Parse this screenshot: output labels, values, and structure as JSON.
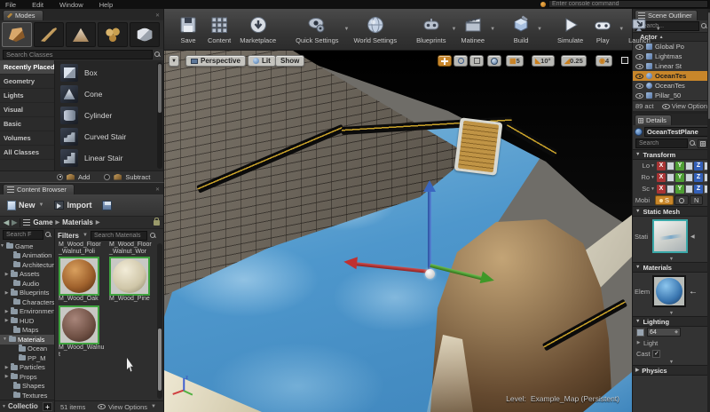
{
  "menu": {
    "items": [
      {
        "label": "File"
      },
      {
        "label": "Edit"
      },
      {
        "label": "Window"
      },
      {
        "label": "Help"
      }
    ]
  },
  "console": {
    "placeholder": "Enter console command"
  },
  "toolbar": {
    "buttons": [
      {
        "label": "Save"
      },
      {
        "label": "Content"
      },
      {
        "label": "Marketplace"
      },
      {
        "label": "Quick Settings"
      },
      {
        "label": "World Settings"
      },
      {
        "label": "Blueprints"
      },
      {
        "label": "Matinee"
      },
      {
        "label": "Build"
      },
      {
        "label": "Simulate"
      },
      {
        "label": "Play"
      },
      {
        "label": "Launch"
      }
    ]
  },
  "modes": {
    "title": "Modes",
    "search_placeholder": "Search Classes",
    "categories": [
      {
        "label": "Recently Placed"
      },
      {
        "label": "Geometry"
      },
      {
        "label": "Lights"
      },
      {
        "label": "Visual"
      },
      {
        "label": "Basic"
      },
      {
        "label": "Volumes"
      },
      {
        "label": "All Classes"
      }
    ],
    "items": [
      {
        "label": "Box"
      },
      {
        "label": "Cone"
      },
      {
        "label": "Cylinder"
      },
      {
        "label": "Curved Stair"
      },
      {
        "label": "Linear Stair"
      }
    ],
    "add_label": "Add",
    "subtract_label": "Subtract"
  },
  "content_browser": {
    "title": "Content Browser",
    "new_label": "New",
    "import_label": "Import",
    "breadcrumb": {
      "root": "Game",
      "current": "Materials"
    },
    "tree_search_placeholder": "Search F",
    "filters_label": "Filters",
    "search_placeholder": "Search Materials",
    "tree": [
      {
        "label": "Game"
      },
      {
        "label": "Animation"
      },
      {
        "label": "Architecture"
      },
      {
        "label": "Assets"
      },
      {
        "label": "Audio"
      },
      {
        "label": "Blueprints"
      },
      {
        "label": "Characters"
      },
      {
        "label": "Environments"
      },
      {
        "label": "HUD"
      },
      {
        "label": "Maps"
      },
      {
        "label": "Materials"
      },
      {
        "label": "Ocean"
      },
      {
        "label": "PP_M"
      },
      {
        "label": "Particles"
      },
      {
        "label": "Props"
      },
      {
        "label": "Shapes"
      },
      {
        "label": "Textures"
      }
    ],
    "collections_label": "Collectio",
    "asset_labels_top": [
      {
        "name": "M_Wood_Floor_Walnut_Poli"
      },
      {
        "name": "M_Wood_Floor_Walnut_Wor"
      }
    ],
    "assets": [
      {
        "name": "M_Wood_Oak"
      },
      {
        "name": "M_Wood_Pine"
      },
      {
        "name": "M_Wood_Walnut"
      }
    ],
    "status": "51 items",
    "view_options_label": "View Options"
  },
  "outliner": {
    "title": "Scene Outliner",
    "search_placeholder": "Search...",
    "column": "Actor",
    "rows": [
      {
        "label": "Global Po"
      },
      {
        "label": "Lightmas"
      },
      {
        "label": "Linear St"
      },
      {
        "label": "OceanTes"
      },
      {
        "label": "OceanTes"
      },
      {
        "label": "Pillar_50"
      }
    ],
    "footer_count": "89 act",
    "view_options_label": "View Option"
  },
  "details": {
    "title": "Details",
    "actor_name": "OceanTestPlane",
    "search_placeholder": "Search",
    "transform": {
      "title": "Transform",
      "rows": [
        {
          "label": "Lo"
        },
        {
          "label": "Ro"
        },
        {
          "label": "Sc"
        }
      ],
      "axes": [
        "X",
        "Y",
        "Z"
      ],
      "mobility_label": "Mobi",
      "mobility_seg1": "S",
      "mobility_seg3": "N"
    },
    "static_mesh": {
      "title": "Static Mesh",
      "row_label": "Stati"
    },
    "materials": {
      "title": "Materials",
      "row_label": "Elem"
    },
    "lighting": {
      "title": "Lighting",
      "value": "64",
      "row2_label": "Light",
      "row3_label": "Cast"
    },
    "physics": {
      "title": "Physics"
    }
  },
  "viewport": {
    "perspective_label": "Perspective",
    "lit_label": "Lit",
    "show_label": "Show",
    "grid_snap": "5",
    "angle_snap": "10°",
    "scale_snap": "0.25",
    "camera_speed": "4",
    "level_label": "Level:",
    "level_name": "Example_Map (Persistent)"
  }
}
